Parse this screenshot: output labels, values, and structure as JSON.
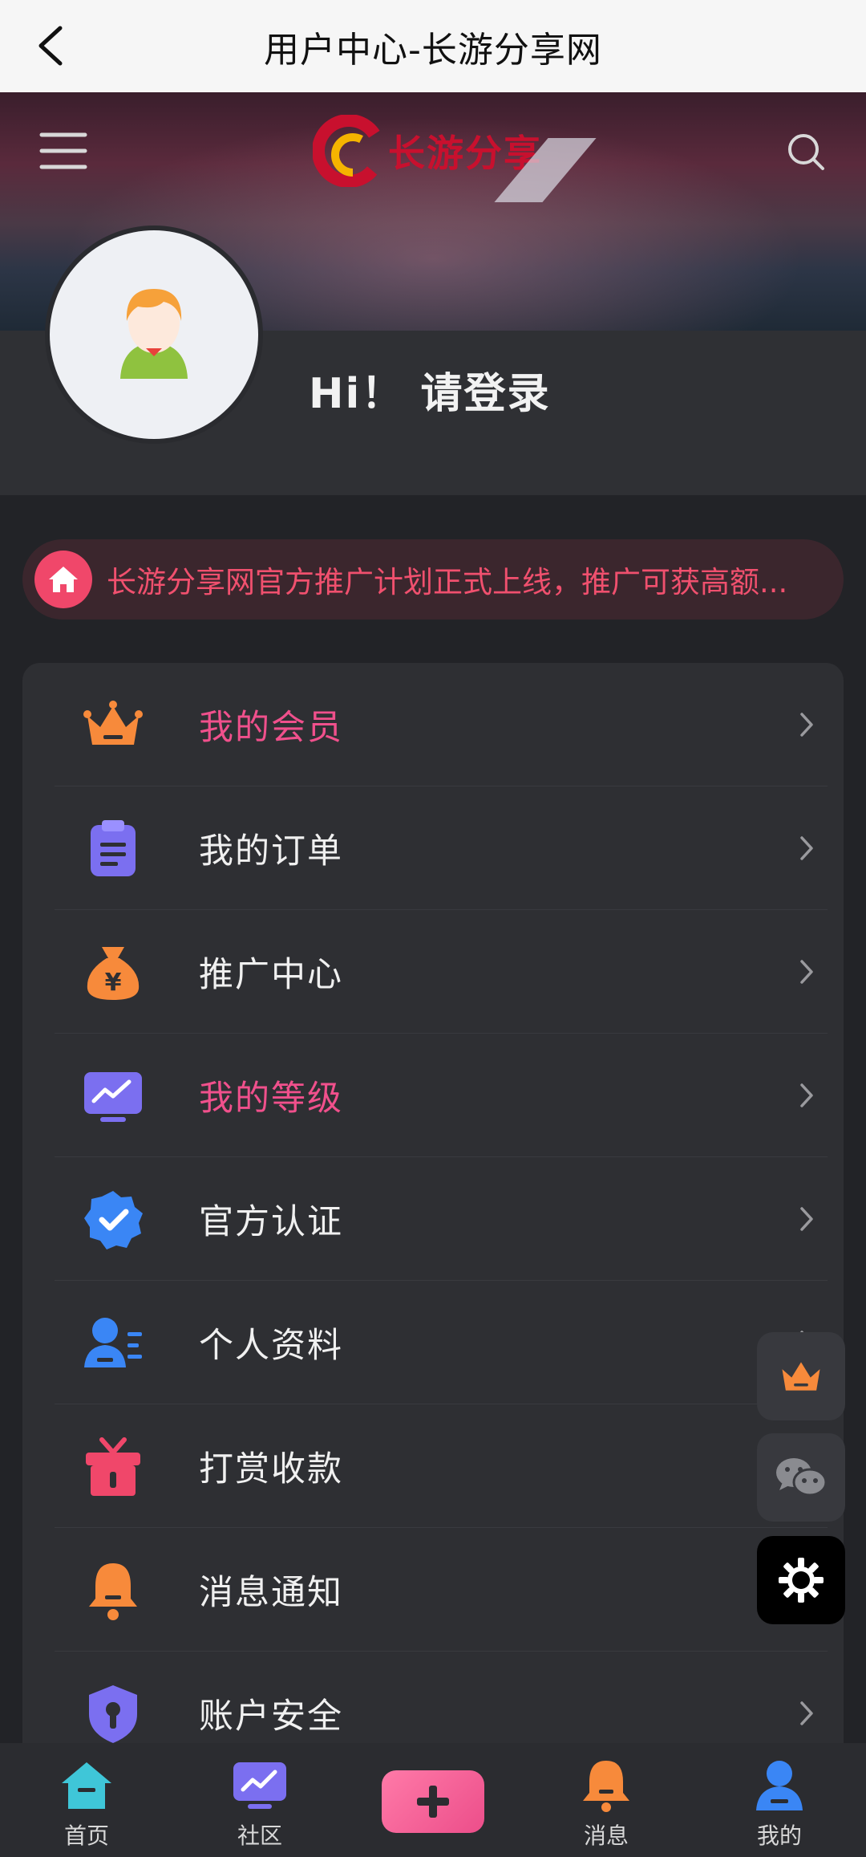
{
  "topbar": {
    "title": "用户中心-长游分享网"
  },
  "header": {
    "logo_text": "长游分享"
  },
  "profile": {
    "greeting": "Hi！ 请登录"
  },
  "notice": {
    "text": "长游分享网官方推广计划正式上线，推广可获高额..."
  },
  "menu": {
    "items": [
      {
        "label": "我的会员",
        "icon": "crown-icon",
        "color": "#f0508c"
      },
      {
        "label": "我的订单",
        "icon": "clipboard-icon",
        "color": "#f0f0f0"
      },
      {
        "label": "推广中心",
        "icon": "money-bag-icon",
        "color": "#f0f0f0"
      },
      {
        "label": "我的等级",
        "icon": "chart-monitor-icon",
        "color": "#f0508c"
      },
      {
        "label": "官方认证",
        "icon": "verified-badge-icon",
        "color": "#f0f0f0"
      },
      {
        "label": "个人资料",
        "icon": "user-profile-icon",
        "color": "#f0f0f0"
      },
      {
        "label": "打赏收款",
        "icon": "gift-icon",
        "color": "#f0f0f0"
      },
      {
        "label": "消息通知",
        "icon": "bell-icon",
        "color": "#f0f0f0"
      },
      {
        "label": "账户安全",
        "icon": "shield-lock-icon",
        "color": "#f0f0f0"
      }
    ]
  },
  "float_buttons": [
    "crown-icon",
    "wechat-icon",
    "settings-gear-icon"
  ],
  "tabbar": {
    "items": [
      {
        "label": "首页",
        "icon": "home-icon"
      },
      {
        "label": "社区",
        "icon": "community-icon"
      },
      {
        "label": "",
        "icon": "plus-icon"
      },
      {
        "label": "消息",
        "icon": "bell-icon"
      },
      {
        "label": "我的",
        "icon": "user-icon"
      }
    ]
  },
  "colors": {
    "accent_pink": "#f0508c",
    "notice_red": "#f0476a",
    "background": "#222327",
    "card": "#2e2f33"
  }
}
